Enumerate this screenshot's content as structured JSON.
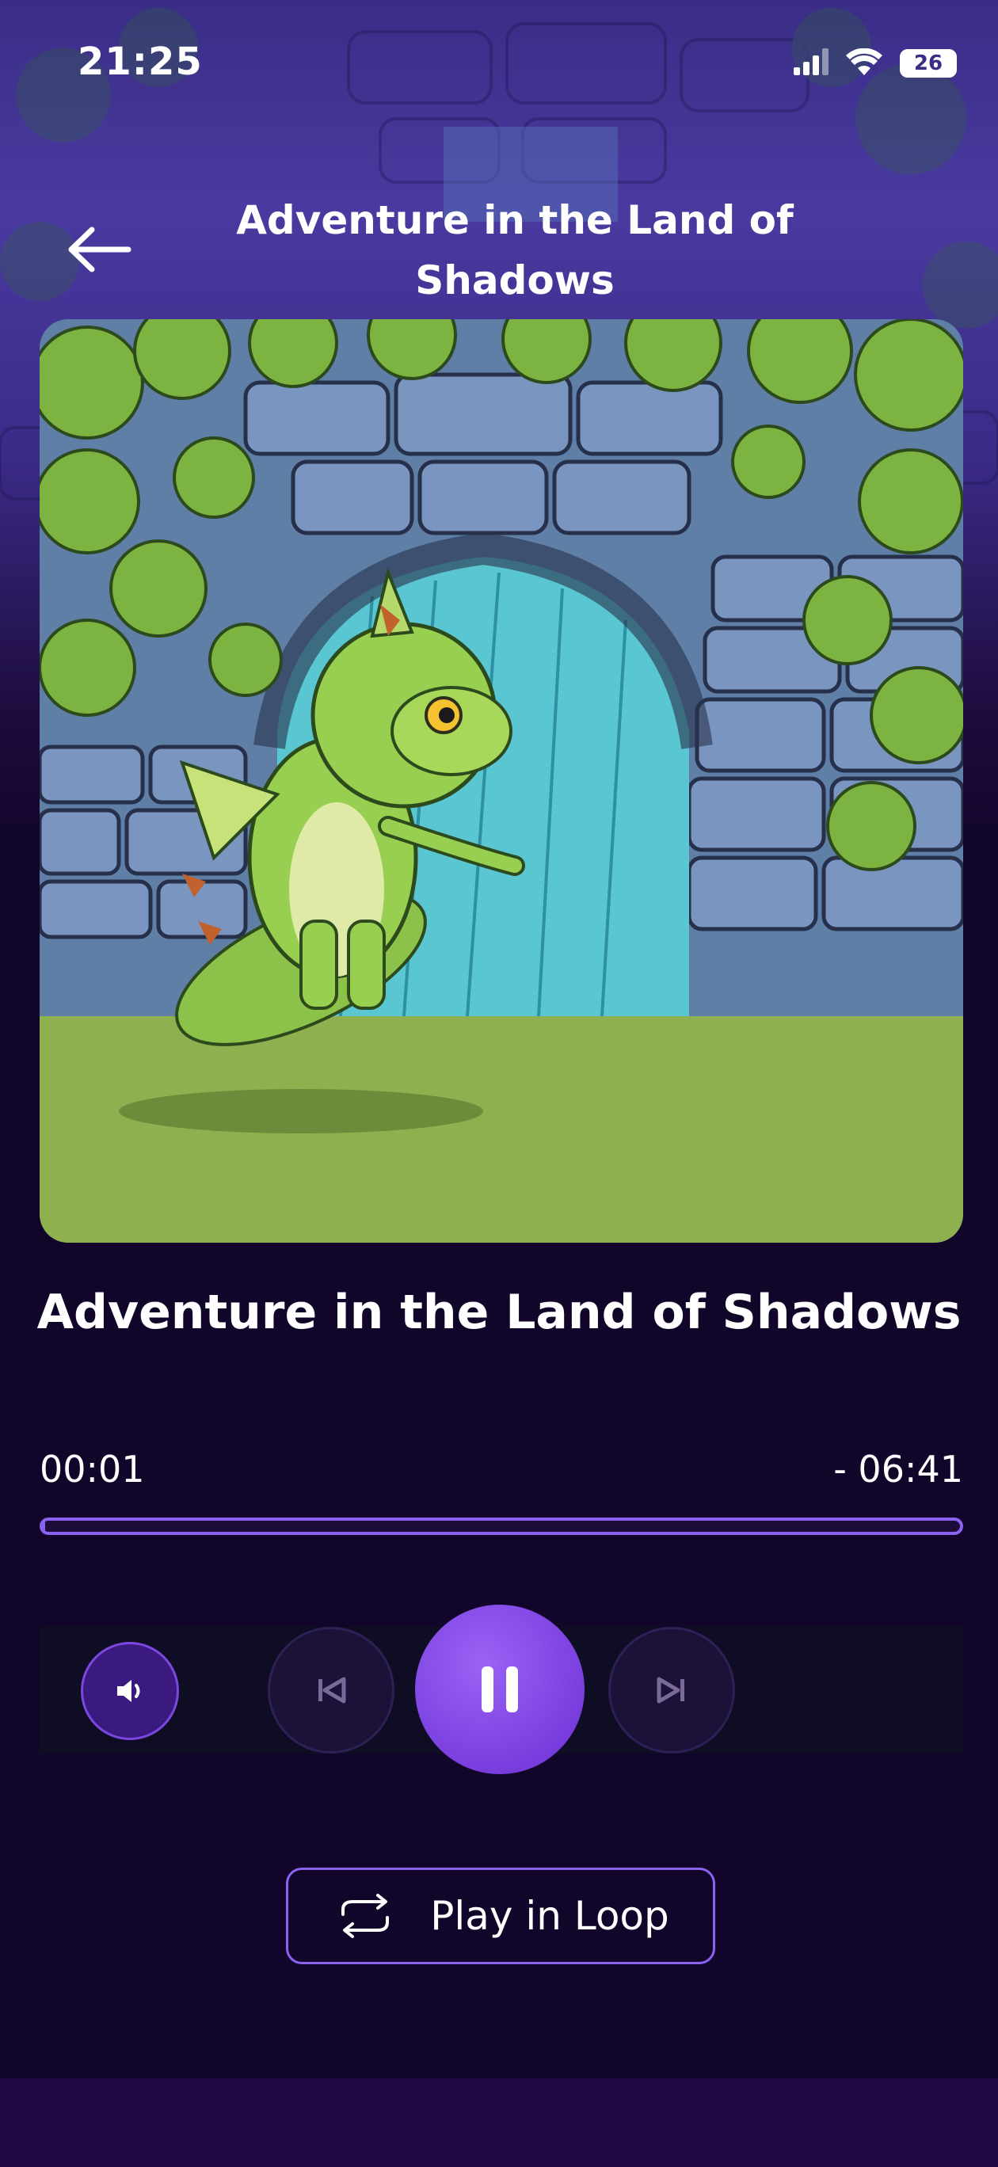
{
  "status_bar": {
    "time": "21:25",
    "battery_level": "26",
    "icons": [
      "signal-icon",
      "wifi-icon",
      "battery-icon"
    ]
  },
  "header": {
    "title": "Adventure in the Land of Shadows",
    "back_icon": "arrow-left-icon"
  },
  "cover": {
    "icon": "cover-illustration"
  },
  "track": {
    "title": "Adventure in the Land of Shadows"
  },
  "player": {
    "elapsed": "00:01",
    "remaining": "- 06:41",
    "progress_fraction": 0.0025,
    "controls": {
      "volume_icon": "speaker-icon",
      "prev_icon": "skip-back-icon",
      "play_icon": "pause-icon",
      "next_icon": "skip-forward-icon"
    }
  },
  "loop": {
    "label": "Play in Loop",
    "icon": "repeat-icon"
  },
  "colors": {
    "accent": "#8b62f0",
    "background": "#12052a",
    "play_button": "#7c3ee6"
  }
}
